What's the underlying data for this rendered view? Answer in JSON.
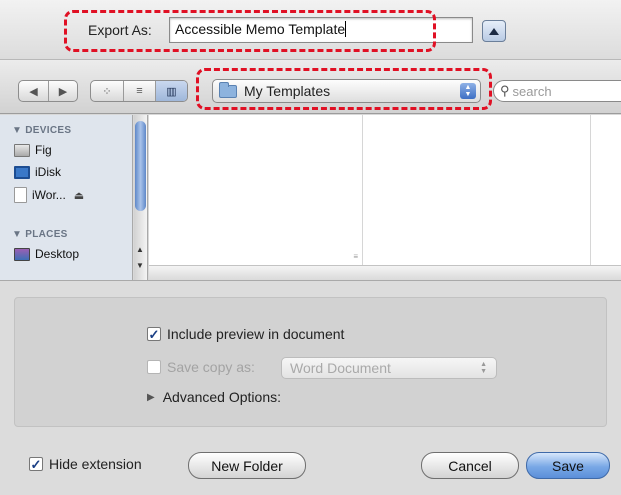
{
  "export": {
    "label": "Export As:",
    "filename": "Accessible Memo Template",
    "expand_button": "collapse-toggle"
  },
  "toolbar": {
    "back_icon": "back-arrow-icon",
    "forward_icon": "forward-arrow-icon",
    "view_icons": [
      "icon-view",
      "list-view",
      "column-view"
    ],
    "location": "My Templates",
    "search_placeholder": "search"
  },
  "sidebar": {
    "devices_header": "DEVICES",
    "devices": [
      {
        "label": "Fig",
        "icon": "hard-drive-icon"
      },
      {
        "label": "iDisk",
        "icon": "idisk-icon"
      },
      {
        "label": "iWor...",
        "icon": "disk-image-icon",
        "ejectable": true
      }
    ],
    "places_header": "PLACES",
    "places": [
      {
        "label": "Desktop",
        "icon": "desktop-icon"
      }
    ]
  },
  "options": {
    "include_preview": {
      "label": "Include preview in document",
      "checked": true
    },
    "save_copy": {
      "label": "Save copy as:",
      "checked": false,
      "enabled": false
    },
    "format": "Word Document",
    "advanced": "Advanced Options:"
  },
  "footer": {
    "hide_extension": {
      "label": "Hide extension",
      "checked": true
    },
    "new_folder": "New Folder",
    "cancel": "Cancel",
    "save": "Save"
  },
  "colors": {
    "highlight": "#e01024",
    "accent": "#5b8fd9"
  }
}
